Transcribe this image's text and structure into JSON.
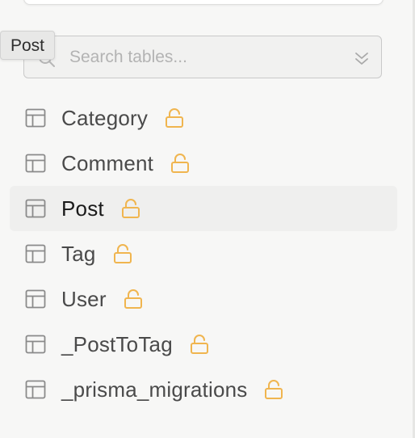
{
  "tooltip": {
    "text": "Post"
  },
  "search": {
    "placeholder": "Search tables..."
  },
  "tables": [
    {
      "label": "Category",
      "selected": false
    },
    {
      "label": "Comment",
      "selected": false
    },
    {
      "label": "Post",
      "selected": true
    },
    {
      "label": "Tag",
      "selected": false
    },
    {
      "label": "User",
      "selected": false
    },
    {
      "label": "_PostToTag",
      "selected": false
    },
    {
      "label": "_prisma_migrations",
      "selected": false
    }
  ],
  "icons": {
    "table": "table-icon",
    "lock": "lock-icon",
    "search": "search-icon",
    "chevron": "chevron-down-icon"
  },
  "colors": {
    "lock": "#f0b54f",
    "icon_gray": "#8a8a8a",
    "selected_bg": "#efefee"
  }
}
